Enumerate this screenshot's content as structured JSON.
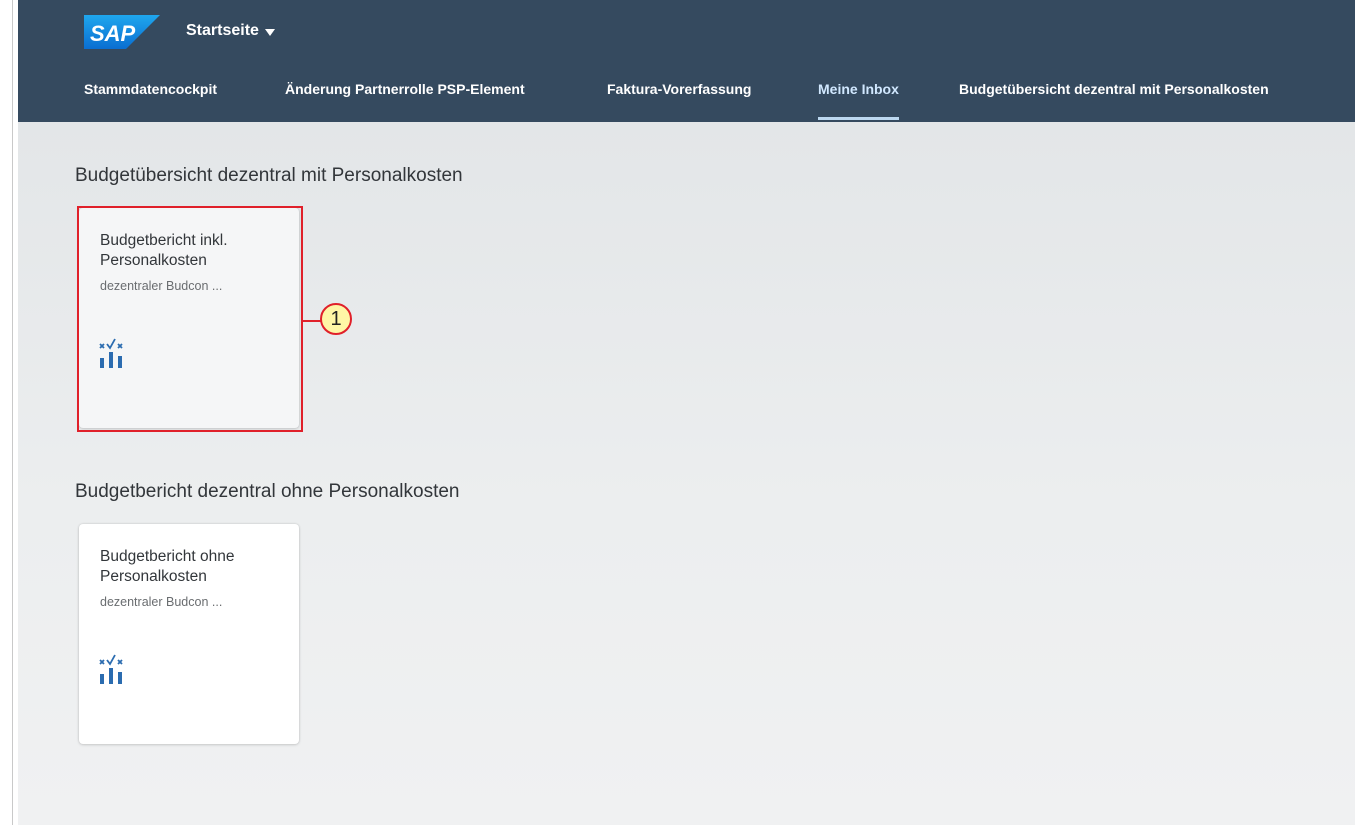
{
  "shell": {
    "logo_text": "SAP",
    "app_title": "Startseite",
    "brand_color": "#354a5f"
  },
  "tabs": [
    {
      "label": "Stammdatencockpit",
      "active": false
    },
    {
      "label": "Änderung Partnerrolle PSP-Element",
      "active": false
    },
    {
      "label": "Faktura-Vorerfassung",
      "active": false
    },
    {
      "label": "Meine Inbox",
      "active": true
    },
    {
      "label": "Budgetübersicht dezentral mit Personalkosten",
      "active": false
    }
  ],
  "sections": [
    {
      "title": "Budgetübersicht dezentral mit Personalkosten",
      "tiles": [
        {
          "title": "Budgetbericht inkl. Personalkosten",
          "subtitle": "dezentraler Budcon ...",
          "icon": "bar-chart-check-icon"
        }
      ]
    },
    {
      "title": "Budgetbericht dezentral ohne Personalkosten",
      "tiles": [
        {
          "title": "Budgetbericht ohne Personalkosten",
          "subtitle": "dezentraler Budcon ...",
          "icon": "bar-chart-check-icon"
        }
      ]
    }
  ],
  "annotation": {
    "callout_number": "1",
    "highlight_color": "#e0202a",
    "callout_fill": "#fff6a6"
  }
}
